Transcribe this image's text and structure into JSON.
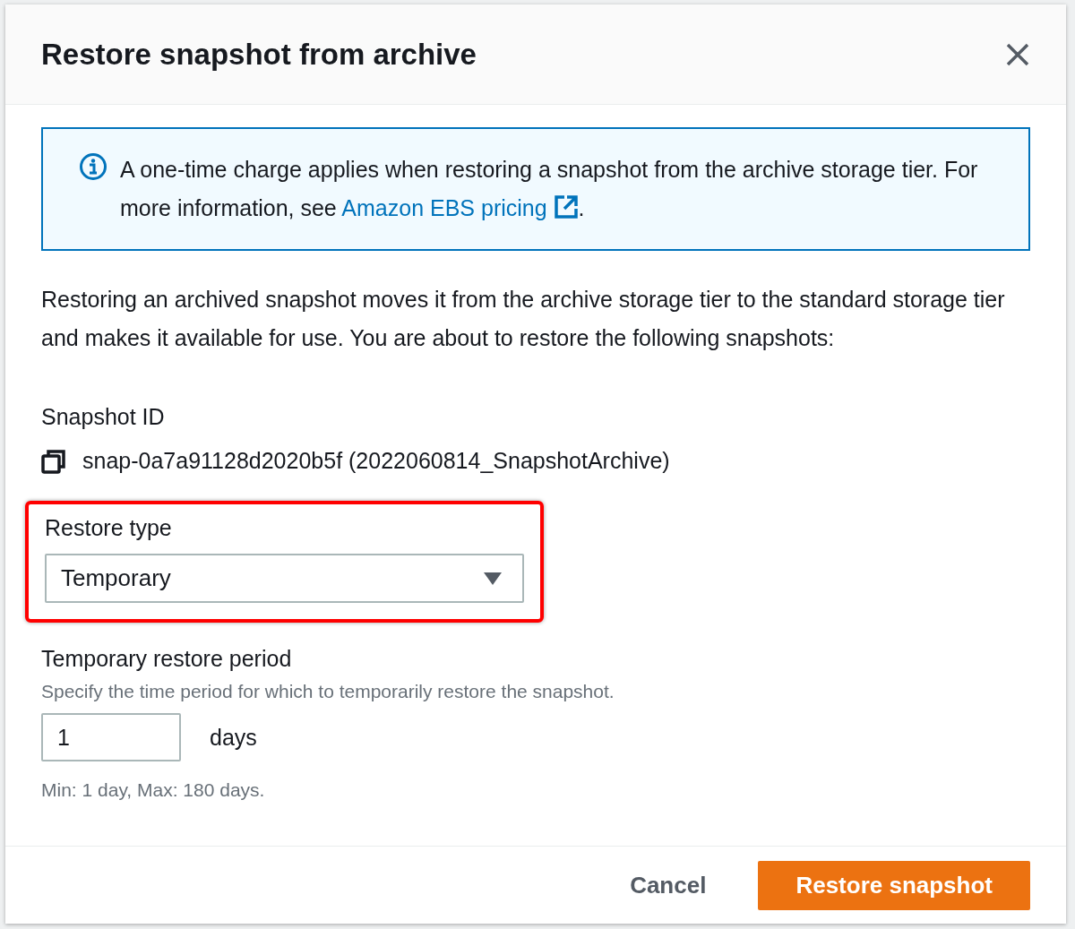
{
  "dialog": {
    "title": "Restore snapshot from archive"
  },
  "alert": {
    "text": "A one-time charge applies when restoring a snapshot from the archive storage tier. For more information, see ",
    "link": "Amazon EBS pricing",
    "after_link": "."
  },
  "description": "Restoring an archived snapshot moves it from the archive storage tier to the standard storage tier and makes it available for use. You are about to restore the following snapshots:",
  "snapshot_id": {
    "label": "Snapshot ID",
    "value": "snap-0a7a91128d2020b5f (2022060814_SnapshotArchive)"
  },
  "restore_type": {
    "label": "Restore type",
    "value": "Temporary",
    "highlighted": true
  },
  "period": {
    "label": "Temporary restore period",
    "description": "Specify the time period for which to temporarily restore the snapshot.",
    "value": "1",
    "unit": "days",
    "constraint": "Min: 1 day, Max: 180 days."
  },
  "buttons": [
    {
      "label": "Cancel",
      "kind": "link"
    },
    {
      "label": "Restore snapshot",
      "kind": "primary"
    }
  ]
}
